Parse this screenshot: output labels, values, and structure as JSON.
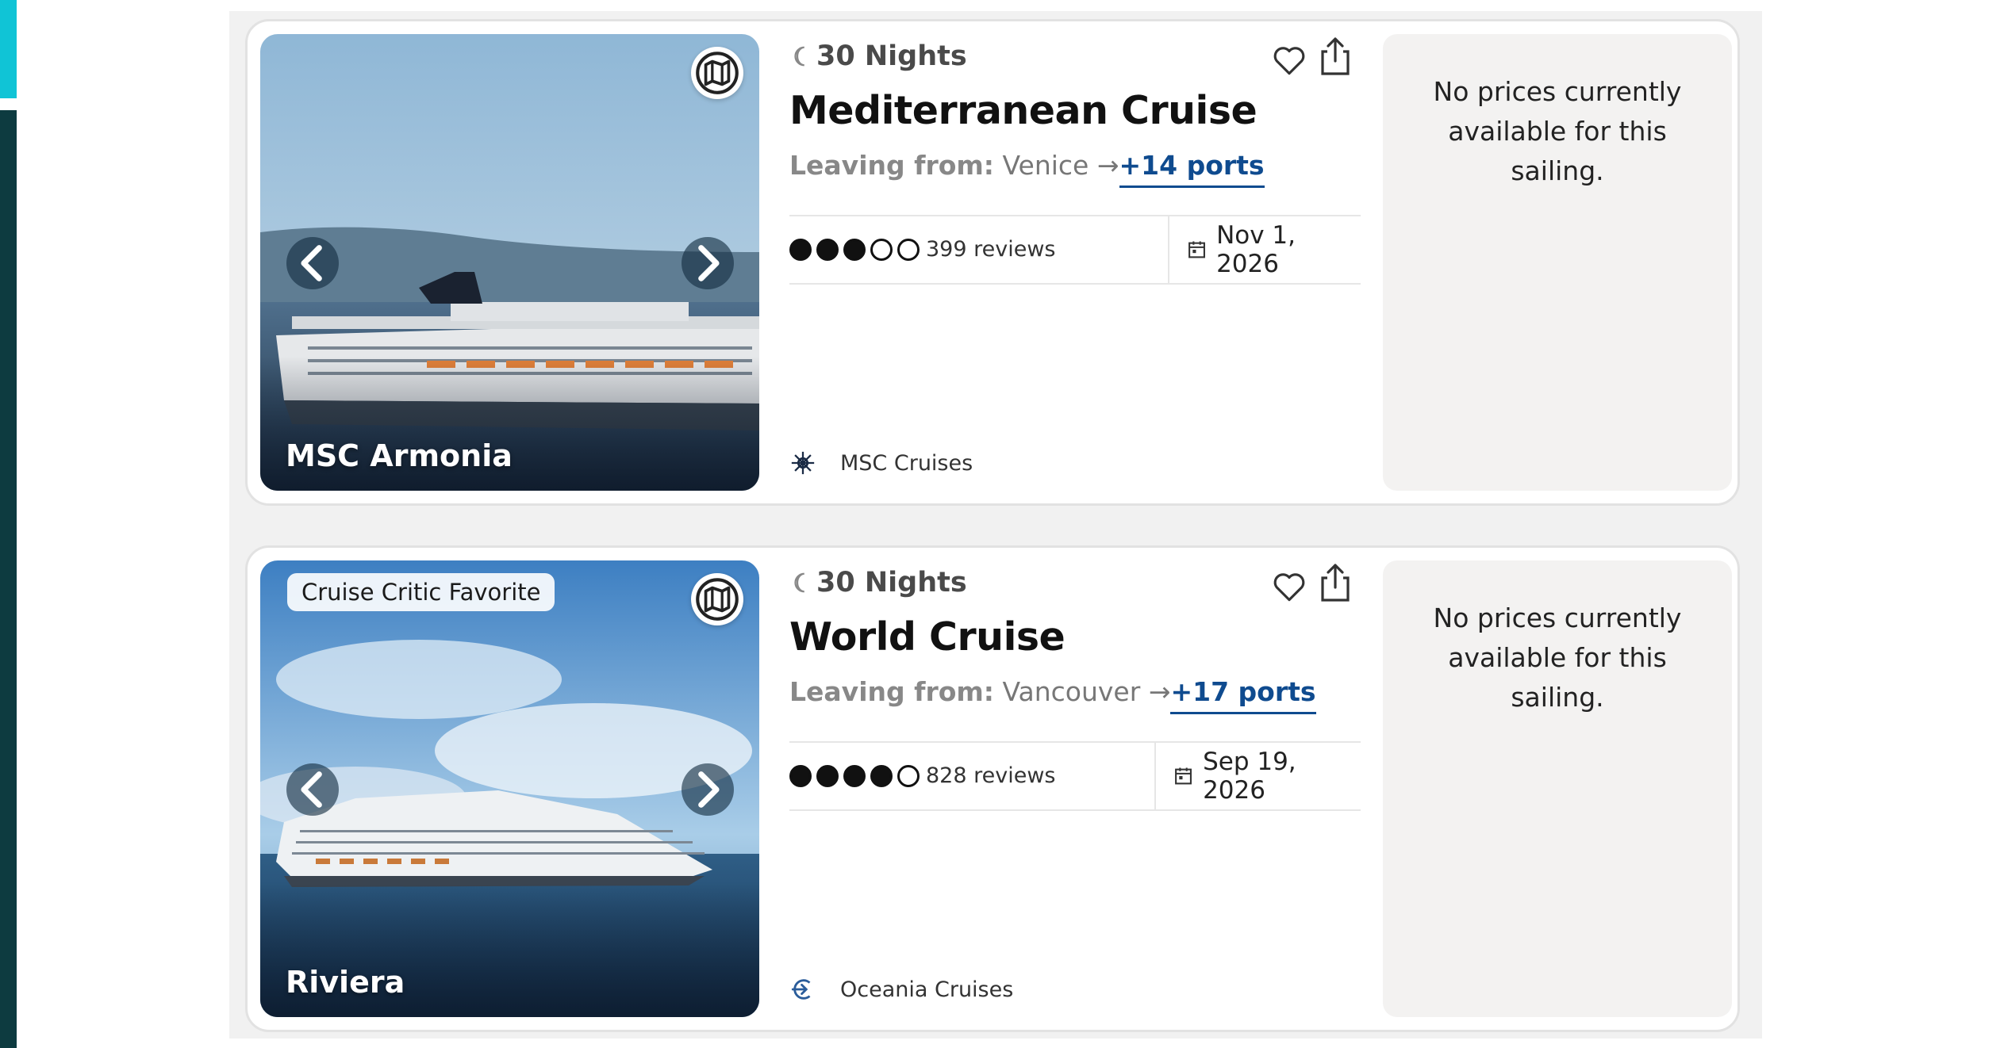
{
  "cards": [
    {
      "ship_name": "MSC Armonia",
      "badge": "",
      "nights": "30 Nights",
      "title": "Mediterranean Cruise",
      "leaving_label": "Leaving from:",
      "leaving_port": "Venice",
      "ports_link": "+14 ports",
      "rating": 3,
      "rating_max": 5,
      "reviews": "399 reviews",
      "date": "Nov 1, 2026",
      "cruise_line": "MSC Cruises",
      "price_note": "No prices currently available for this sailing."
    },
    {
      "ship_name": "Riviera",
      "badge": "Cruise Critic Favorite",
      "nights": "30 Nights",
      "title": "World Cruise",
      "leaving_label": "Leaving from:",
      "leaving_port": "Vancouver",
      "ports_link": "+17 ports",
      "rating": 4,
      "rating_max": 5,
      "reviews": "828 reviews",
      "date": "Sep 19, 2026",
      "cruise_line": "Oceania Cruises",
      "price_note": "No prices currently available for this sailing."
    }
  ],
  "colors": {
    "accent_teal": "#10c4d6",
    "accent_dark": "#0d3b40",
    "link_blue": "#0f4b8f",
    "price_box_bg": "#f3f2f1"
  },
  "icons": [
    "moon-icon",
    "heart-icon",
    "share-icon",
    "map-icon",
    "chevron-left-icon",
    "chevron-right-icon",
    "calendar-icon",
    "cruise-line-logo-icon"
  ]
}
